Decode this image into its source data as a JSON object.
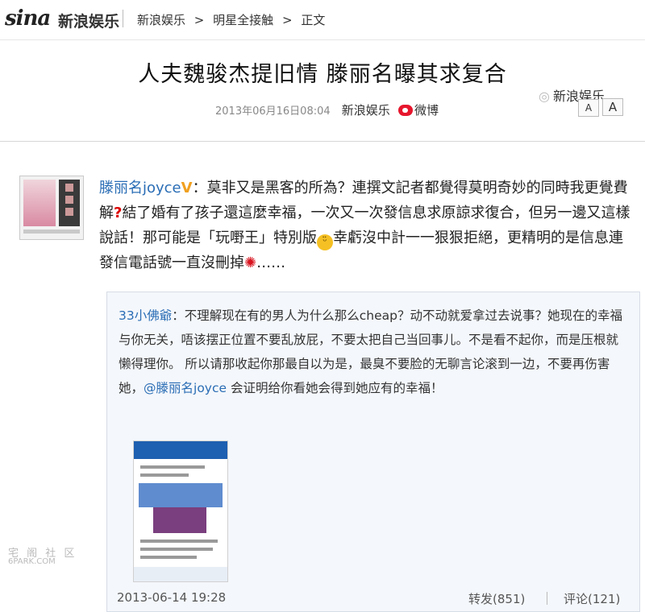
{
  "header": {
    "logo_text": "sina",
    "logo_sub": "新浪娱乐",
    "breadcrumb": [
      "新浪娱乐",
      ">",
      "明星全接触",
      ">",
      "正文"
    ]
  },
  "article": {
    "title": "人夫魏骏杰提旧情 滕丽名曝其求复合",
    "date": "2013年06月16日08:04",
    "source": "新浪娱乐",
    "weibo_label": "微博",
    "brand_right": "新浪娱乐",
    "font_small": "A",
    "font_large": "A"
  },
  "post": {
    "username": "滕丽名joyce",
    "verified_badge": "V",
    "text_1": "：莫非又是黑客的所為？連撰文記者都覺得莫明奇妙的同時我更覺費解",
    "qmark": "?",
    "text_2": "結了婚有了孩子還這麼幸福，一次又一次發信息求原諒求復合，但另一邊又這樣說話！那可能是「玩嘢王」特別版",
    "emoji_face": "😑",
    "text_3": "幸虧沒中計一一狠狠拒絕，更精明的是信息連發信電話號一直沒刪掉",
    "angry_icon": "💢",
    "text_4": "……"
  },
  "repost": {
    "username": "33小佛爺",
    "text_1": "：不理解现在有的男人为什么那么cheap？动不动就爱拿过去说事？她现在的幸福与你无关，唔该摆正位置不要乱放屁，不要太把自己当回事儿。不是看不起你，而是压根就懒得理你。 所以请那收起你那最自以为是，最臭不要脸的无聊言论滚到一边，不要再伤害她，",
    "mention": "@滕丽名joyce",
    "text_2": " 会证明给你看她会得到她应有的幸福！",
    "time": "2013-06-14 19:28",
    "forward": "转发(851)",
    "comment": "评论(121)"
  },
  "watermark": {
    "line1": "宅 阁 社 区",
    "line2": "6PARK.COM"
  },
  "colors": {
    "link_blue": "#2a6db5",
    "sina_red": "#e8000d",
    "repost_bg": "#f4f7fb"
  }
}
